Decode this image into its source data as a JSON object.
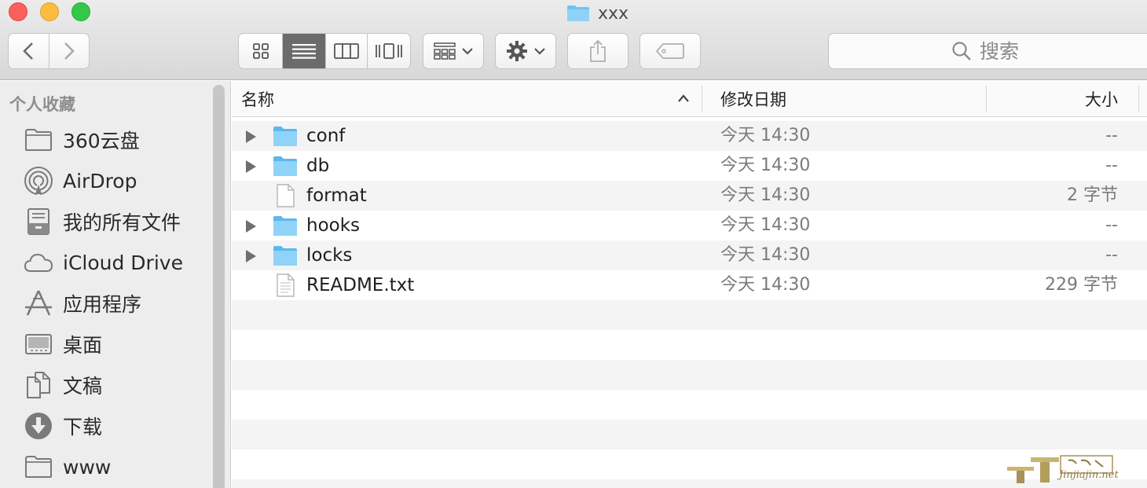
{
  "window": {
    "title": "xxx"
  },
  "toolbar": {
    "back_icon": "chevron-left-icon",
    "forward_icon": "chevron-right-icon",
    "view_modes": [
      "icon-view-icon",
      "list-view-icon",
      "column-view-icon",
      "cover-flow-icon"
    ],
    "active_view": "list-view-icon",
    "arrange_icon": "arrange-grid-icon",
    "action_icon": "gear-icon",
    "share_icon": "share-icon",
    "tag_icon": "tag-icon",
    "search_placeholder": "搜索"
  },
  "sidebar": {
    "heading": "个人收藏",
    "items": [
      {
        "label": "360云盘",
        "icon": "folder-icon"
      },
      {
        "label": "AirDrop",
        "icon": "airdrop-icon"
      },
      {
        "label": "我的所有文件",
        "icon": "all-files-icon"
      },
      {
        "label": "iCloud Drive",
        "icon": "cloud-icon"
      },
      {
        "label": "应用程序",
        "icon": "applications-icon"
      },
      {
        "label": "桌面",
        "icon": "desktop-icon"
      },
      {
        "label": "文稿",
        "icon": "documents-icon"
      },
      {
        "label": "下载",
        "icon": "download-icon"
      },
      {
        "label": "www",
        "icon": "folder-icon"
      }
    ]
  },
  "list": {
    "columns": {
      "name": "名称",
      "modified": "修改日期",
      "size": "大小"
    },
    "rows": [
      {
        "name": "conf",
        "type": "folder",
        "modified": "今天 14:30",
        "size": "--"
      },
      {
        "name": "db",
        "type": "folder",
        "modified": "今天 14:30",
        "size": "--"
      },
      {
        "name": "format",
        "type": "file",
        "modified": "今天 14:30",
        "size": "2 字节"
      },
      {
        "name": "hooks",
        "type": "folder",
        "modified": "今天 14:30",
        "size": "--"
      },
      {
        "name": "locks",
        "type": "folder",
        "modified": "今天 14:30",
        "size": "--"
      },
      {
        "name": "README.txt",
        "type": "text-file",
        "modified": "今天 14:30",
        "size": "229 字节"
      }
    ]
  },
  "watermark": {
    "text": "Jinjiajin.net"
  },
  "colors": {
    "folder": "#6ec2f0",
    "accent_active": "#6b6b6b"
  }
}
